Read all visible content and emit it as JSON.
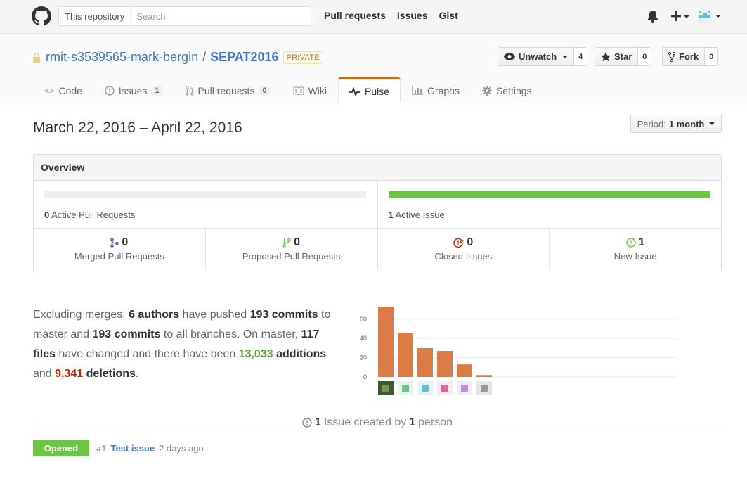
{
  "header": {
    "search_scope": "This repository",
    "search_placeholder": "Search",
    "nav": [
      "Pull requests",
      "Issues",
      "Gist"
    ],
    "icons": [
      "github-logo",
      "bell-icon",
      "plus-icon",
      "avatar"
    ]
  },
  "repo": {
    "owner": "rmit-s3539565-mark-bergin",
    "separator": "/",
    "name": "SEPAT2016",
    "visibility": "PRIVATE",
    "watch_label": "Unwatch",
    "watch_count": "4",
    "star_label": "Star",
    "star_count": "0",
    "fork_label": "Fork",
    "fork_count": "0"
  },
  "tabs": [
    {
      "label": "Code",
      "icon": "code-icon"
    },
    {
      "label": "Issues",
      "icon": "issue-icon",
      "badge": "1"
    },
    {
      "label": "Pull requests",
      "icon": "pr-icon",
      "badge": "0"
    },
    {
      "label": "Wiki",
      "icon": "book-icon"
    },
    {
      "label": "Pulse",
      "icon": "pulse-icon",
      "selected": true
    },
    {
      "label": "Graphs",
      "icon": "graph-icon"
    },
    {
      "label": "Settings",
      "icon": "gear-icon"
    }
  ],
  "pulse": {
    "date_range": "March 22, 2016 – April 22, 2016",
    "period_label": "Period:",
    "period_value": "1 month"
  },
  "overview": {
    "title": "Overview",
    "active_prs_count": "0",
    "active_prs_label": "Active Pull Requests",
    "active_issues_count": "1",
    "active_issues_label": "Active Issue",
    "stats": [
      {
        "value": "0",
        "label": "Merged Pull Requests",
        "icon": "merge-icon",
        "color": "#6e5494"
      },
      {
        "value": "0",
        "label": "Proposed Pull Requests",
        "icon": "pr-icon",
        "color": "#6cc644"
      },
      {
        "value": "0",
        "label": "Closed Issues",
        "icon": "issue-closed-icon",
        "color": "#bd2c00"
      },
      {
        "value": "1",
        "label": "New Issue",
        "icon": "issue-opened-icon",
        "color": "#6cc644"
      }
    ]
  },
  "commits": {
    "p1": "Excluding merges,",
    "authors": "6 authors",
    "p2": "have pushed",
    "commits_master": "193 commits",
    "p3": "to master and",
    "commits_all": "193 commits",
    "p4": "to all branches. On master,",
    "files": "117 files",
    "p5": "have changed and there have been",
    "additions_num": "13,033",
    "additions_word": "additions",
    "p6": "and",
    "deletions_num": "9,341",
    "deletions_word": "deletions",
    "p7": "."
  },
  "chart_data": {
    "type": "bar",
    "categories": [
      "author-1",
      "author-2",
      "author-3",
      "author-4",
      "author-5",
      "author-6"
    ],
    "values": [
      73,
      46,
      30,
      27,
      13,
      2
    ],
    "yticks": [
      0,
      20,
      40,
      60
    ],
    "ylim": [
      0,
      75
    ],
    "bar_color": "#db7c46",
    "grid": true
  },
  "issues": {
    "summary_count": "1",
    "summary_word": "Issue created by",
    "summary_people": "1",
    "summary_person": "person",
    "list": [
      {
        "state": "Opened",
        "number": "#1",
        "title": "Test issue",
        "age": "2 days ago"
      }
    ]
  }
}
